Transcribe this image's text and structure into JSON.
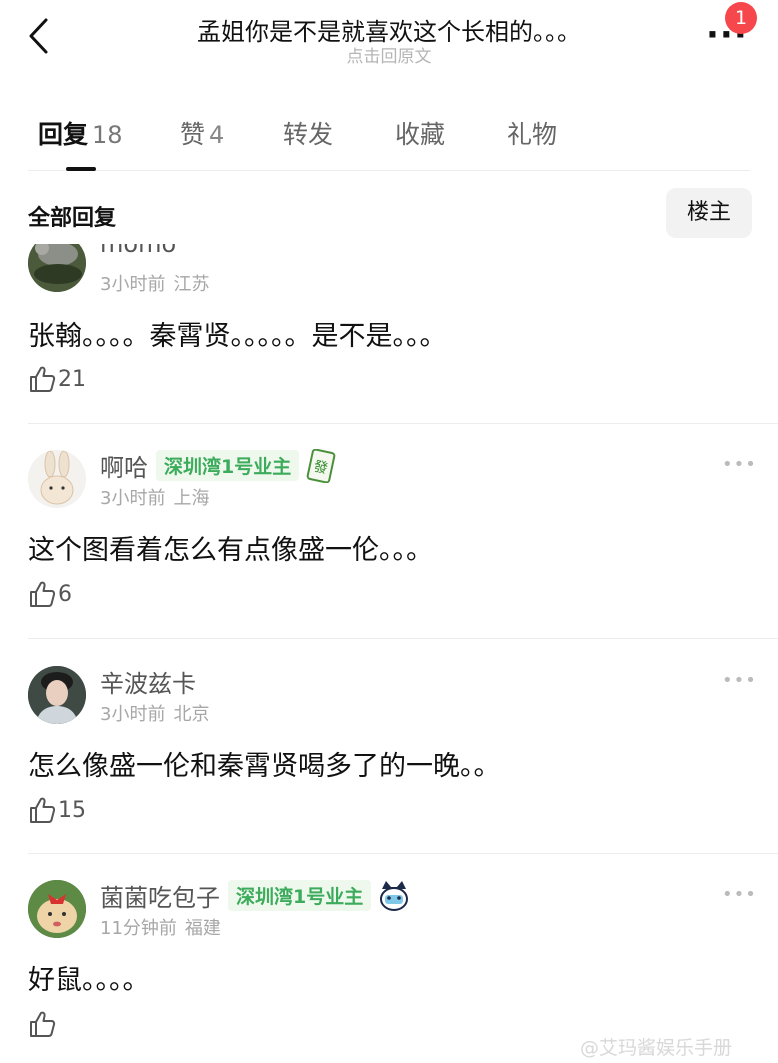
{
  "header": {
    "title": "孟姐你是不是就喜欢这个长相的。。。",
    "subtitle": "点击回原文",
    "badge_count": "1"
  },
  "tabs": [
    {
      "label": "回复",
      "count": "18",
      "active": true
    },
    {
      "label": "赞",
      "count": "4"
    },
    {
      "label": "转发",
      "count": ""
    },
    {
      "label": "收藏",
      "count": ""
    },
    {
      "label": "礼物",
      "count": ""
    }
  ],
  "reply_bar": {
    "all_replies_label": "全部回复",
    "louzhu_label": "楼主"
  },
  "comments": [
    {
      "username": "momo",
      "time": "3小时前",
      "location": "江苏",
      "text": "张翰。。。。秦霄贤。。。。。是不是。。。",
      "likes": "21"
    },
    {
      "username": "啊哈",
      "tag": "深圳湾1号业主",
      "time": "3小时前",
      "location": "上海",
      "text": "这个图看着怎么有点像盛一伦。。。",
      "likes": "6",
      "emblem_icon": "mahjong-fa-tile-icon"
    },
    {
      "username": "辛波兹卡",
      "time": "3小时前",
      "location": "北京",
      "text": "怎么像盛一伦和秦霄贤喝多了的一晚。。",
      "likes": "15"
    },
    {
      "username": "菌菌吃包子",
      "tag": "深圳湾1号业主",
      "time": "11分钟前",
      "location": "福建",
      "text": "好鼠。。。。",
      "likes": "",
      "emblem_icon": "cartoon-cat-sticker-icon"
    }
  ],
  "more_dots": "•••",
  "watermark": "@艾玛酱娱乐手册",
  "colors": {
    "tag_green": "#3dab5c",
    "badge_red": "#f5474c",
    "meta_gray": "#a7a7a7"
  }
}
